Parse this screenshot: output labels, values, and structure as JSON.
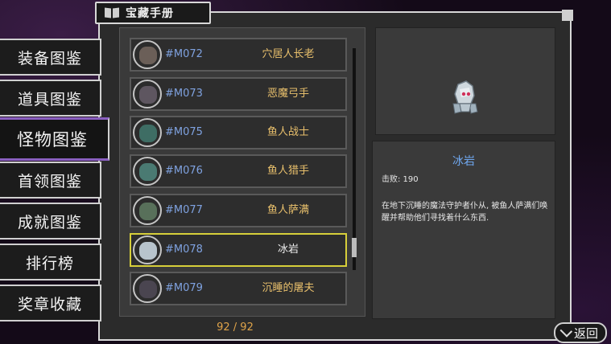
{
  "header": {
    "title": "宝藏手册"
  },
  "nav": {
    "items": [
      {
        "label": "装备图鉴"
      },
      {
        "label": "道具图鉴"
      },
      {
        "label": "怪物图鉴"
      },
      {
        "label": "首领图鉴"
      },
      {
        "label": "成就图鉴"
      },
      {
        "label": "排行榜"
      },
      {
        "label": "奖章收藏"
      }
    ],
    "active": "怪物图鉴"
  },
  "list": {
    "rows": [
      {
        "code": "#M072",
        "name": "穴居人长老",
        "portrait_color": "#6b5f58"
      },
      {
        "code": "#M073",
        "name": "恶魔弓手",
        "portrait_color": "#5e5660"
      },
      {
        "code": "#M075",
        "name": "鱼人战士",
        "portrait_color": "#3e6d64"
      },
      {
        "code": "#M076",
        "name": "鱼人猎手",
        "portrait_color": "#4a7a72"
      },
      {
        "code": "#M077",
        "name": "鱼人萨满",
        "portrait_color": "#58705a"
      },
      {
        "code": "#M078",
        "name": "冰岩",
        "portrait_color": "#b8c4cc"
      },
      {
        "code": "#M079",
        "name": "沉睡的屠夫",
        "portrait_color": "#4a4550"
      }
    ],
    "selected_code": "#M078",
    "page_count": "92 / 92"
  },
  "detail": {
    "name": "冰岩",
    "defeated": "击败: 190",
    "description": "在地下沉睡的魔法守护者仆从, 被鱼人萨满们唤醒并帮助他们寻找着什么东西."
  },
  "footer": {
    "back_label": "返回"
  },
  "colors": {
    "accent_purple": "#8a5fc0",
    "selected_border": "#d7cf3a",
    "code_blue": "#7fa2e0",
    "name_gold": "#e9c06c",
    "detail_name_blue": "#6fa7ef"
  },
  "icons": {
    "header": "book-icon",
    "back": "back-arrow-icon"
  }
}
